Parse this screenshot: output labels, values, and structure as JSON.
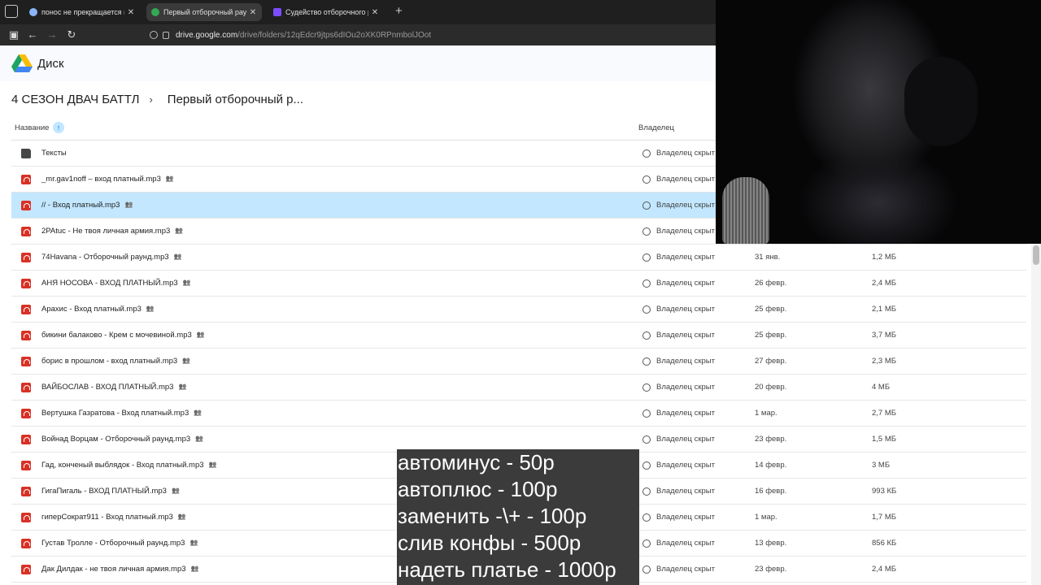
{
  "browser": {
    "tabs": [
      {
        "title": "понос не прекращается неделю",
        "favicon_color": "#8ab4f8",
        "active": false
      },
      {
        "title": "Первый отборочный раунд – Google Диск",
        "favicon_color": "#34a853",
        "active": true
      },
      {
        "title": "Судейство отборочного раунда",
        "favicon_color": "#7c4dff",
        "active": false
      }
    ],
    "close_glyph": "✕",
    "new_tab_glyph": "+",
    "url_host": "drive.google.com",
    "url_path": "/drive/folders/12qEdcr9jtps6dIOu2oXK0RPnmbolJOot"
  },
  "drive": {
    "app_name": "Диск",
    "breadcrumb": [
      "4 СЕЗОН ДВАЧ БАТТЛ",
      "Первый отборочный р..."
    ],
    "columns": {
      "name": "Название",
      "owner": "Владелец"
    },
    "rows": [
      {
        "name": "Тексты",
        "type": "folder",
        "shared": false,
        "owner": "Владелец скрыт",
        "date": "",
        "size": ""
      },
      {
        "name": "_mr.gav1noff – вход платный.mp3",
        "type": "audio",
        "shared": true,
        "owner": "Владелец скрыт",
        "date": "",
        "size": ""
      },
      {
        "name": "// - Вход платный.mp3",
        "type": "audio",
        "shared": true,
        "owner": "Владелец скрыт",
        "date": "",
        "size": "",
        "selected": true
      },
      {
        "name": "2PAtuc - Не твоя личная армия.mp3",
        "type": "audio",
        "shared": true,
        "owner": "Владелец скрыт",
        "date": "",
        "size": ""
      },
      {
        "name": "74Havana - Отборочный раунд.mp3",
        "type": "audio",
        "shared": true,
        "owner": "Владелец скрыт",
        "date": "31 янв.",
        "size": "1,2 МБ"
      },
      {
        "name": "АНЯ НОСОВА - ВХОД ПЛАТНЫЙ.mp3",
        "type": "audio",
        "shared": true,
        "owner": "Владелец скрыт",
        "date": "26 февр.",
        "size": "2,4 МБ"
      },
      {
        "name": "Арахис - Вход платный.mp3",
        "type": "audio",
        "shared": true,
        "owner": "Владелец скрыт",
        "date": "25 февр.",
        "size": "2,1 МБ"
      },
      {
        "name": "бикини балаково - Крем с мочевиной.mp3",
        "type": "audio",
        "shared": true,
        "owner": "Владелец скрыт",
        "date": "25 февр.",
        "size": "3,7 МБ"
      },
      {
        "name": "борис в прошлом - вход платный.mp3",
        "type": "audio",
        "shared": true,
        "owner": "Владелец скрыт",
        "date": "27 февр.",
        "size": "2,3 МБ"
      },
      {
        "name": "ВАЙБОСЛАВ - ВХОД ПЛАТНЫЙ.mp3",
        "type": "audio",
        "shared": true,
        "owner": "Владелец скрыт",
        "date": "20 февр.",
        "size": "4 МБ"
      },
      {
        "name": "Вертушка Газратова - Вход платный.mp3",
        "type": "audio",
        "shared": true,
        "owner": "Владелец скрыт",
        "date": "1 мар.",
        "size": "2,7 МБ"
      },
      {
        "name": "Войнад Ворцам - Отборочный раунд.mp3",
        "type": "audio",
        "shared": true,
        "owner": "Владелец скрыт",
        "date": "23 февр.",
        "size": "1,5 МБ"
      },
      {
        "name": "Гад, конченый выблядок - Вход платный.mp3",
        "type": "audio",
        "shared": true,
        "owner": "Владелец скрыт",
        "date": "14 февр.",
        "size": "3 МБ"
      },
      {
        "name": "ГигаПигаль - ВХОД ПЛАТНЫЙ.mp3",
        "type": "audio",
        "shared": true,
        "owner": "Владелец скрыт",
        "date": "16 февр.",
        "size": "993 КБ"
      },
      {
        "name": "гиперСократ911 - Вход платный.mp3",
        "type": "audio",
        "shared": true,
        "owner": "Владелец скрыт",
        "date": "1 мар.",
        "size": "1,7 МБ"
      },
      {
        "name": "Густав Тролле - Отборочный раунд.mp3",
        "type": "audio",
        "shared": true,
        "owner": "Владелец скрыт",
        "date": "13 февр.",
        "size": "856 КБ"
      },
      {
        "name": "Дак  Дилдак - не твоя личная армия.mp3",
        "type": "audio",
        "shared": true,
        "owner": "Владелец скрыт",
        "date": "23 февр.",
        "size": "2,4 МБ"
      }
    ]
  },
  "overlay": {
    "price_lines": [
      "автоминус - 50р",
      "автоплюс - 100р",
      "заменить -\\+ - 100р",
      "слив конфы - 500р",
      "надеть платье - 1000р"
    ]
  }
}
